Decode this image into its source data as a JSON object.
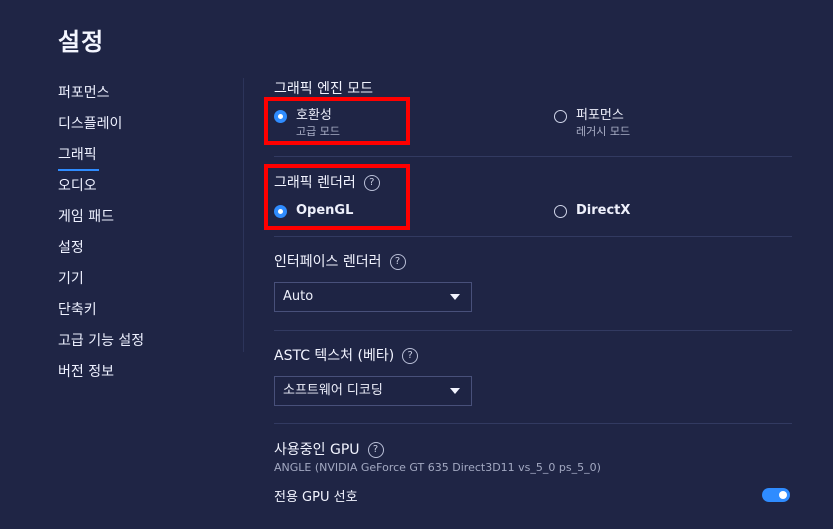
{
  "window": {
    "title": "설정"
  },
  "sidebar": {
    "items": [
      {
        "label": "퍼포먼스"
      },
      {
        "label": "디스플레이"
      },
      {
        "label": "그래픽"
      },
      {
        "label": "오디오"
      },
      {
        "label": "게임 패드"
      },
      {
        "label": "설정"
      },
      {
        "label": "기기"
      },
      {
        "label": "단축키"
      },
      {
        "label": "고급 기능 설정"
      },
      {
        "label": "버전 정보"
      }
    ],
    "active_item": "그래픽"
  },
  "graphics_engine_mode": {
    "title": "그래픽 엔진 모드",
    "options": [
      {
        "label": "호환성",
        "sublabel": "고급 모드",
        "selected": true
      },
      {
        "label": "퍼포먼스",
        "sublabel": "레거시 모드",
        "selected": false
      }
    ]
  },
  "graphics_renderer": {
    "title": "그래픽 렌더러",
    "help_glyph": "?",
    "options": [
      {
        "label": "OpenGL",
        "selected": true
      },
      {
        "label": "DirectX",
        "selected": false
      }
    ]
  },
  "interface_renderer": {
    "title": "인터페이스 렌더러",
    "help_glyph": "?",
    "selected_value": "Auto"
  },
  "astc_texture": {
    "title": "ASTC 텍스처 (베타)",
    "help_glyph": "?",
    "selected_value": "소프트웨어 디코딩"
  },
  "gpu_in_use": {
    "title": "사용중인 GPU",
    "help_glyph": "?",
    "description": "ANGLE (NVIDIA GeForce GT 635 Direct3D11 vs_5_0 ps_5_0)",
    "prefer_dedicated_label": "전용 GPU 선호",
    "prefer_dedicated_enabled": true
  },
  "colors": {
    "background": "#1f2545",
    "accent": "#2f8cff",
    "highlight": "#ff0000"
  },
  "icons": [
    "help-icon",
    "chevron-down-icon",
    "radio-icon",
    "toggle-switch"
  ]
}
